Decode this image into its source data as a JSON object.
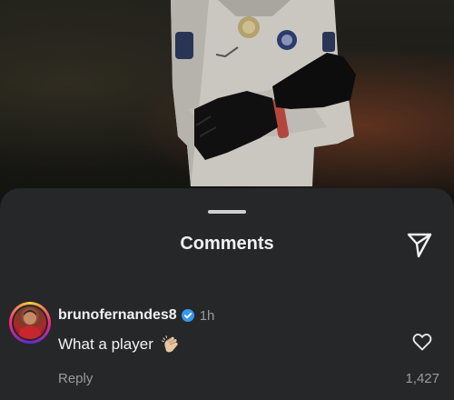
{
  "sheet": {
    "title": "Comments",
    "share_icon": "send-icon"
  },
  "comment": {
    "username": "brunofernandes8",
    "verified": true,
    "time": "1h",
    "text": "What a player",
    "emoji": "clapping-hands",
    "reply_label": "Reply",
    "like_count": "1,427",
    "like_icon": "heart-icon"
  },
  "colors": {
    "sheet_background": "#262729",
    "text_primary": "#f2f2f2",
    "text_secondary": "#9a9a9a",
    "verified_badge": "#3897f0"
  }
}
